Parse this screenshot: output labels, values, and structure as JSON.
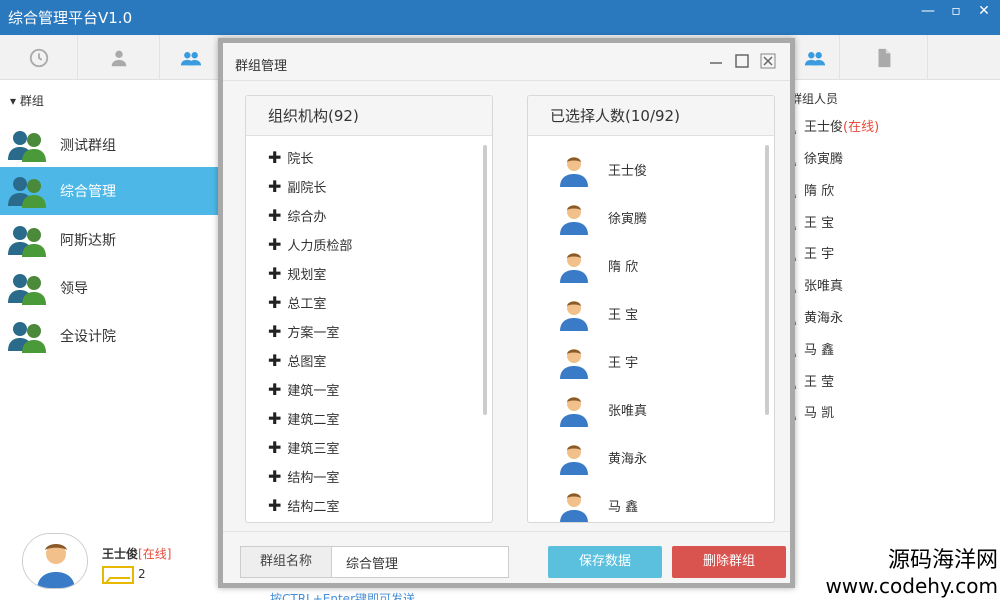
{
  "window": {
    "title": "综合管理平台V1.0"
  },
  "tabs": [
    {
      "icon": "clock-icon"
    },
    {
      "icon": "user-icon"
    },
    {
      "icon": "group-icon"
    },
    {
      "icon": "group-icon"
    },
    {
      "icon": "document-icon"
    }
  ],
  "sidebar": {
    "header": "群组",
    "items": [
      {
        "label": "测试群组",
        "active": false
      },
      {
        "label": "综合管理",
        "active": true
      },
      {
        "label": "阿斯达斯",
        "active": false
      },
      {
        "label": "领导",
        "active": false
      },
      {
        "label": "全设计院",
        "active": false
      }
    ]
  },
  "profile": {
    "name": "王士俊",
    "status": "[在线]",
    "message_count": "2"
  },
  "members": {
    "title": "群组人员",
    "list": [
      {
        "name": "王士俊",
        "status": "(在线)"
      },
      {
        "name": "徐寅腾",
        "status": ""
      },
      {
        "name": "隋 欣",
        "status": ""
      },
      {
        "name": "王 宝",
        "status": ""
      },
      {
        "name": "王 宇",
        "status": ""
      },
      {
        "name": "张唯真",
        "status": ""
      },
      {
        "name": "黄海永",
        "status": ""
      },
      {
        "name": "马 鑫",
        "status": ""
      },
      {
        "name": "王 莹",
        "status": ""
      },
      {
        "name": "马 凯",
        "status": ""
      }
    ]
  },
  "hint": "按CTRL+Enter键即可发送",
  "dialog": {
    "title": "群组管理",
    "org_panel": {
      "title": "组织机构(92)",
      "items": [
        "院长",
        "副院长",
        "综合办",
        "人力质检部",
        "规划室",
        "总工室",
        "方案一室",
        "总图室",
        "建筑一室",
        "建筑二室",
        "建筑三室",
        "结构一室",
        "结构二室"
      ]
    },
    "selected_panel": {
      "title": "已选择人数(10/92)",
      "items": [
        "王士俊",
        "徐寅腾",
        "隋 欣",
        "王 宝",
        "王 宇",
        "张唯真",
        "黄海永",
        "马 鑫"
      ]
    },
    "footer": {
      "name_label": "群组名称",
      "name_value": "综合管理",
      "save_label": "保存数据",
      "delete_label": "删除群组"
    }
  },
  "watermark": {
    "line1": "源码海洋网",
    "line2": "www.codehy.com"
  },
  "colors": {
    "titlebar": "#2a78be",
    "active": "#4db8e8",
    "save": "#5bc0de",
    "delete": "#d9534f",
    "online": "#e74c3c"
  }
}
